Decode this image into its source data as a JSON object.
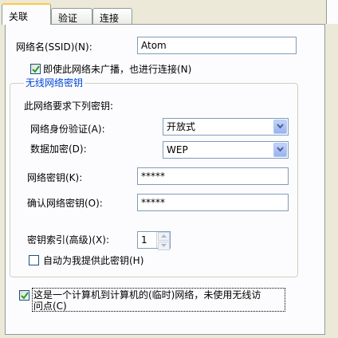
{
  "tabs": [
    {
      "label": "关联",
      "active": true
    },
    {
      "label": "验证",
      "active": false
    },
    {
      "label": "连接",
      "active": false
    }
  ],
  "ssid": {
    "label": "网络名(SSID)(N):",
    "value": "Atom"
  },
  "connect_even_if_not_broadcasting": {
    "label": "即使此网络未广播，也进行连接(N)",
    "checked": true
  },
  "wireless_key_group": {
    "title": "无线网络密钥",
    "requires_text": "此网络要求下列密钥:",
    "authentication": {
      "label": "网络身份验证(A):",
      "value": "开放式"
    },
    "encryption": {
      "label": "数据加密(D):",
      "value": "WEP"
    },
    "network_key": {
      "label": "网络密钥(K):",
      "value": "*****"
    },
    "confirm_key": {
      "label": "确认网络密钥(O):",
      "value": "*****"
    },
    "key_index": {
      "label": "密钥索引(高级)(X):",
      "value": "1"
    },
    "auto_provide_key": {
      "label": "自动为我提供此密钥(H)",
      "checked": false
    }
  },
  "adhoc": {
    "label_line1": "这是一个计算机到计算机的(临时)网络，未使用无线访",
    "label_line2": "问点(C)",
    "checked": true
  },
  "colors": {
    "accent_tab": "#ffc83c",
    "group_title": "#0046d5",
    "border": "#7f9db9"
  }
}
